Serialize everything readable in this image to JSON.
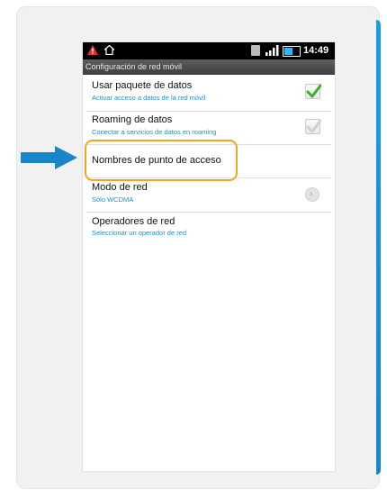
{
  "status_bar": {
    "time": "14:49",
    "warning_icon": "warning-triangle-icon",
    "home_icon": "home-icon",
    "battery_level_percent": 55
  },
  "title_bar": {
    "title": "Configuración de red móvil"
  },
  "settings": [
    {
      "label": "Usar paquete de datos",
      "sub": "Activar acceso a datos de la red móvil",
      "control": "checkbox",
      "checked": true,
      "enabled": true
    },
    {
      "label": "Roaming de datos",
      "sub": "Conectar a servicios de datos en roaming",
      "control": "checkbox",
      "checked": true,
      "enabled": false
    },
    {
      "label": "Nombres de punto de acceso",
      "sub": "",
      "control": "none",
      "highlighted": true
    },
    {
      "label": "Modo de red",
      "sub": "Sólo WCDMA",
      "control": "chevron"
    },
    {
      "label": "Operadores de red",
      "sub": "Seleccionar un operador de red",
      "control": "none"
    }
  ],
  "annotation": {
    "arrow_color": "#1a86c8",
    "highlight_color": "#f0a623"
  }
}
